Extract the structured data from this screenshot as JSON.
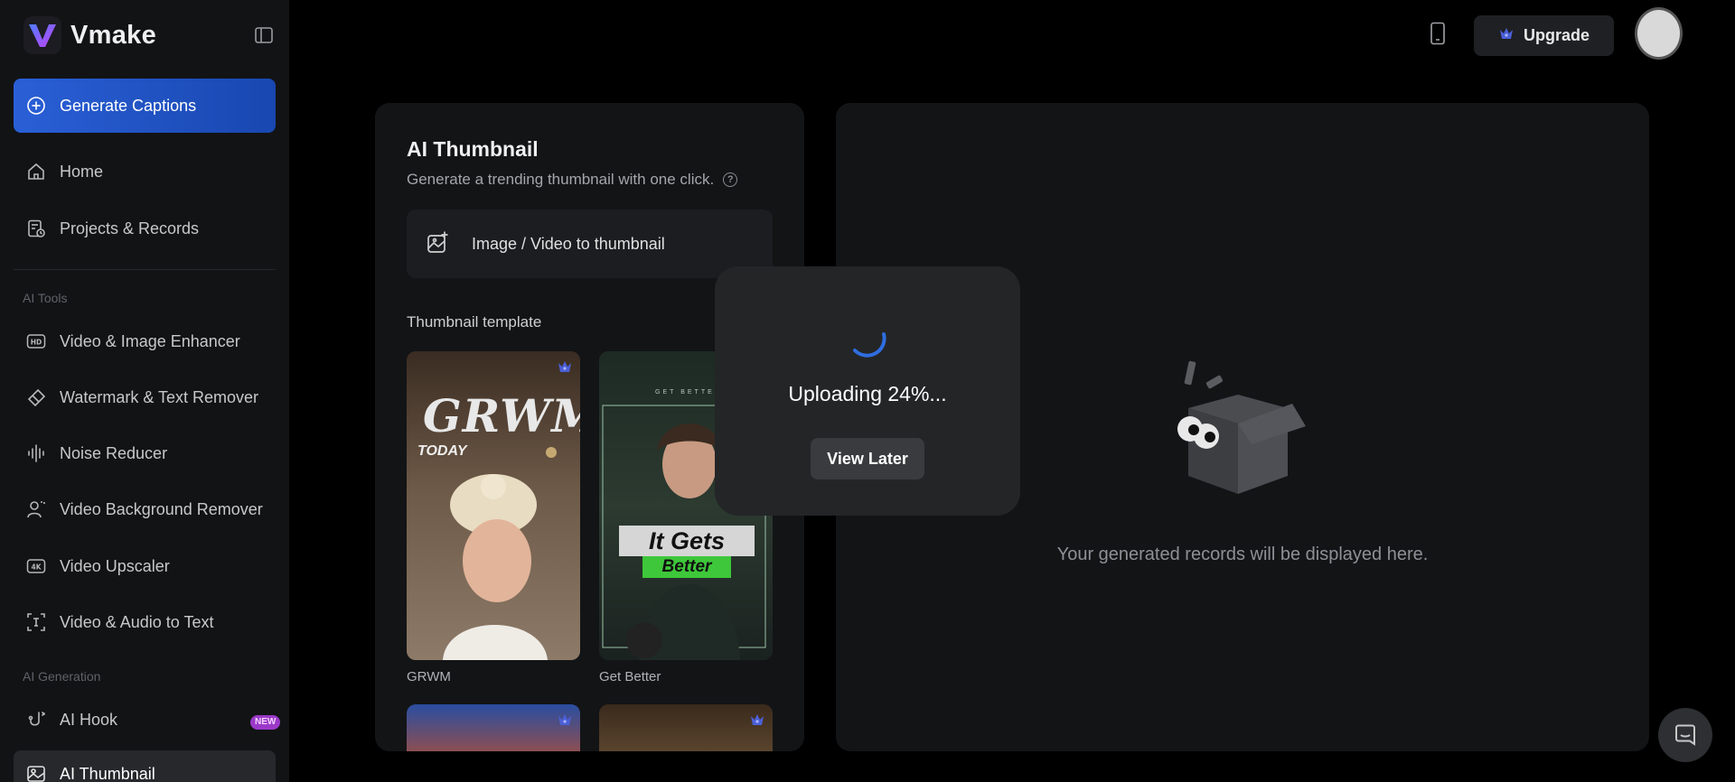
{
  "brand": {
    "name": "Vmake"
  },
  "sidebar": {
    "generate_label": "Generate Captions",
    "items": [
      {
        "label": "Home",
        "icon": "home-icon"
      },
      {
        "label": "Projects & Records",
        "icon": "records-icon"
      }
    ],
    "ai_tools_label": "AI Tools",
    "tools": [
      {
        "label": "Video & Image Enhancer",
        "icon": "hd-icon"
      },
      {
        "label": "Watermark & Text Remover",
        "icon": "eraser-icon"
      },
      {
        "label": "Noise Reducer",
        "icon": "waveform-icon"
      },
      {
        "label": "Video Background Remover",
        "icon": "person-bg-icon"
      },
      {
        "label": "Video Upscaler",
        "icon": "4k-icon"
      },
      {
        "label": "Video & Audio to Text",
        "icon": "text-scan-icon"
      }
    ],
    "ai_generation_label": "AI Generation",
    "generation": [
      {
        "label": "AI Hook",
        "icon": "hook-icon",
        "badge": "NEW"
      },
      {
        "label": "AI Thumbnail",
        "icon": "thumbnail-icon"
      }
    ]
  },
  "topbar": {
    "upgrade_label": "Upgrade"
  },
  "main": {
    "title": "AI Thumbnail",
    "subtitle": "Generate a trending thumbnail with one click.",
    "help_glyph": "?",
    "image_to_thumbnail_label": "Image / Video to thumbnail",
    "template_label": "Thumbnail template",
    "templates": [
      {
        "name": "GRWM",
        "overlay_title": "GRWM",
        "overlay_sub": "TODAY"
      },
      {
        "name": "Get Better",
        "overlay_title": "It Gets",
        "overlay_sub": "Better",
        "overlay_top": "GET BETTER"
      }
    ]
  },
  "records": {
    "empty_text": "Your generated records will be displayed here."
  },
  "modal": {
    "status_text": "Uploading 24%...",
    "progress_percent": 24,
    "view_later_label": "View Later"
  },
  "colors": {
    "accent": "#2a5fd6",
    "new_badge": "#9b39c9",
    "crown": "#4b5fd6"
  }
}
